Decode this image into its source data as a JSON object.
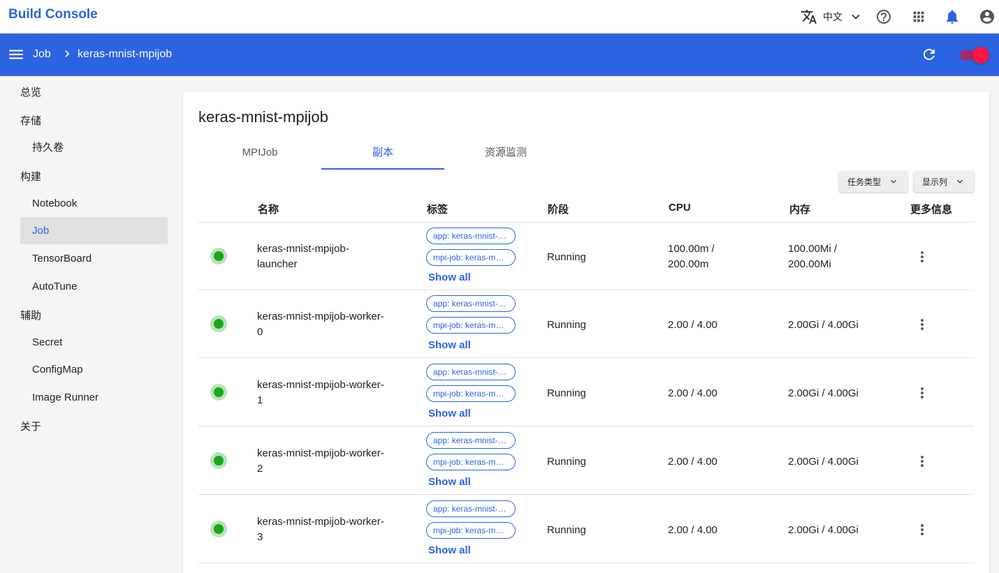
{
  "app": {
    "title": "Build Console",
    "language": "中文"
  },
  "breadcrumb": {
    "root": "Job",
    "current": "keras-mnist-mpijob"
  },
  "sidebar": {
    "groups": [
      {
        "label": "总览"
      },
      {
        "label": "存储",
        "items": [
          "持久卷"
        ]
      },
      {
        "label": "构建",
        "items": [
          "Notebook",
          "Job",
          "TensorBoard",
          "AutoTune"
        ]
      },
      {
        "label": "辅助",
        "items": [
          "Secret",
          "ConfigMap",
          "Image Runner"
        ]
      },
      {
        "label": "关于"
      }
    ],
    "active": "Job"
  },
  "page": {
    "title": "keras-mnist-mpijob",
    "tabs": [
      "MPIJob",
      "副本",
      "资源监测"
    ],
    "active_tab": "副本",
    "filters": {
      "task_type": "任务类型",
      "columns": "显示列"
    }
  },
  "table": {
    "headers": {
      "name": "名称",
      "labels": "标签",
      "phase": "阶段",
      "cpu": "CPU",
      "memory": "内存",
      "more": "更多信息"
    },
    "show_all": "Show all",
    "rows": [
      {
        "name1": "keras-mnist-mpijob-",
        "name2": "launcher",
        "label1": "app: keras-mnist-mpijob",
        "label2": "mpi-job: keras-mnist-mpijob",
        "phase": "Running",
        "cpu1": "100.00m /",
        "cpu2": "200.00m",
        "mem1": "100.00Mi /",
        "mem2": "200.00Mi"
      },
      {
        "name1": "keras-mnist-mpijob-worker-",
        "name2": "0",
        "label1": "app: keras-mnist-mpijob",
        "label2": "mpi-job: keras-mnist-mpijob",
        "phase": "Running",
        "cpu1": "2.00 / 4.00",
        "cpu2": "",
        "mem1": "2.00Gi / 4.00Gi",
        "mem2": ""
      },
      {
        "name1": "keras-mnist-mpijob-worker-",
        "name2": "1",
        "label1": "app: keras-mnist-mpijob",
        "label2": "mpi-job: keras-mnist-mpijob",
        "phase": "Running",
        "cpu1": "2.00 / 4.00",
        "cpu2": "",
        "mem1": "2.00Gi / 4.00Gi",
        "mem2": ""
      },
      {
        "name1": "keras-mnist-mpijob-worker-",
        "name2": "2",
        "label1": "app: keras-mnist-mpijob",
        "label2": "mpi-job: keras-mnist-mpijob",
        "phase": "Running",
        "cpu1": "2.00 / 4.00",
        "cpu2": "",
        "mem1": "2.00Gi / 4.00Gi",
        "mem2": ""
      },
      {
        "name1": "keras-mnist-mpijob-worker-",
        "name2": "3",
        "label1": "app: keras-mnist-mpijob",
        "label2": "mpi-job: keras-mnist-mpijob",
        "phase": "Running",
        "cpu1": "2.00 / 4.00",
        "cpu2": "",
        "mem1": "2.00Gi / 4.00Gi",
        "mem2": ""
      }
    ]
  },
  "colors": {
    "brand": "#2c63e0",
    "running": "#17a81b",
    "toggle": "#ff1744"
  },
  "icons": [
    "translate-icon",
    "chevron-down-icon",
    "help-icon",
    "apps-icon",
    "bell-icon",
    "account-icon",
    "menu-icon",
    "chevron-right-icon",
    "refresh-icon",
    "more-vert-icon"
  ]
}
